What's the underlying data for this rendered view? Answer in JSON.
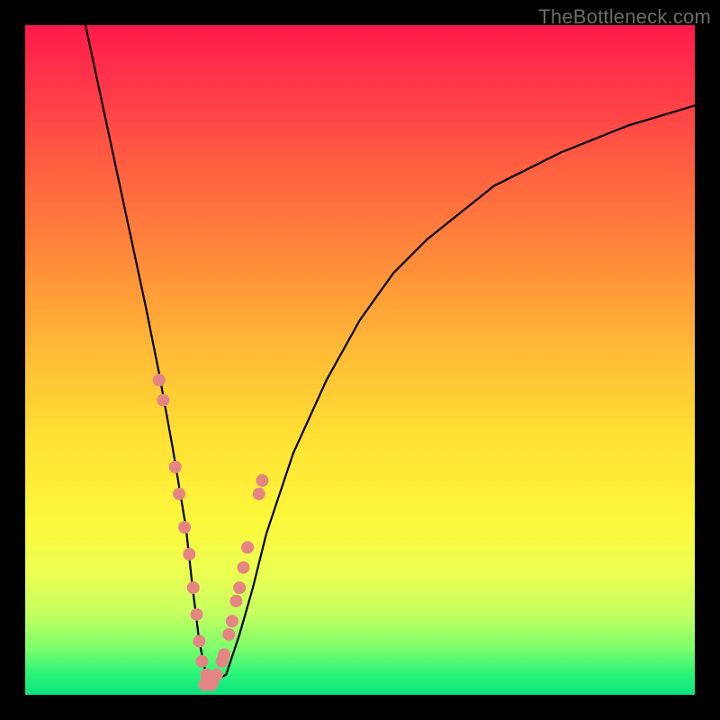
{
  "watermark": "TheBottleneck.com",
  "colors": {
    "frame": "#000000",
    "curve": "#000000",
    "marker_fill": "#e58583",
    "marker_stroke": "#cf6f6d",
    "gradient_top": "#ff1a4b",
    "gradient_bottom": "#0be47e"
  },
  "chart_data": {
    "type": "line",
    "title": "",
    "xlabel": "",
    "ylabel": "",
    "xlim": [
      0,
      100
    ],
    "ylim": [
      0,
      100
    ],
    "grid": false,
    "legend": false,
    "annotations": [
      "TheBottleneck.com"
    ],
    "series": [
      {
        "name": "bottleneck-curve",
        "x": [
          9,
          12,
          15,
          18,
          20,
          22,
          24,
          25,
          26,
          27,
          28,
          30,
          32,
          34,
          36,
          40,
          45,
          50,
          55,
          60,
          70,
          80,
          90,
          100
        ],
        "y": [
          100,
          86,
          72,
          58,
          48,
          37,
          25,
          16,
          8,
          3,
          2,
          3,
          9,
          16,
          24,
          36,
          47,
          56,
          63,
          68,
          76,
          81,
          85,
          88
        ]
      },
      {
        "name": "left-branch-markers",
        "x": [
          20.0,
          20.6,
          22.4,
          23.0,
          23.8,
          24.5,
          25.1,
          25.6,
          26.0,
          26.4,
          27.1
        ],
        "y": [
          47,
          44,
          34,
          30,
          25,
          21,
          16,
          12,
          8,
          5,
          3
        ]
      },
      {
        "name": "right-branch-markers",
        "x": [
          28.0,
          28.6,
          29.4,
          29.7,
          30.4,
          30.9,
          31.5,
          32.0,
          32.6,
          33.2,
          34.9,
          35.4
        ],
        "y": [
          2,
          3,
          5,
          6,
          9,
          11,
          14,
          16,
          19,
          22,
          30,
          32
        ]
      },
      {
        "name": "bottom-markers",
        "x": [
          26.8,
          27.1,
          27.5,
          27.8
        ],
        "y": [
          1.5,
          1.5,
          1.5,
          1.5
        ]
      }
    ]
  }
}
